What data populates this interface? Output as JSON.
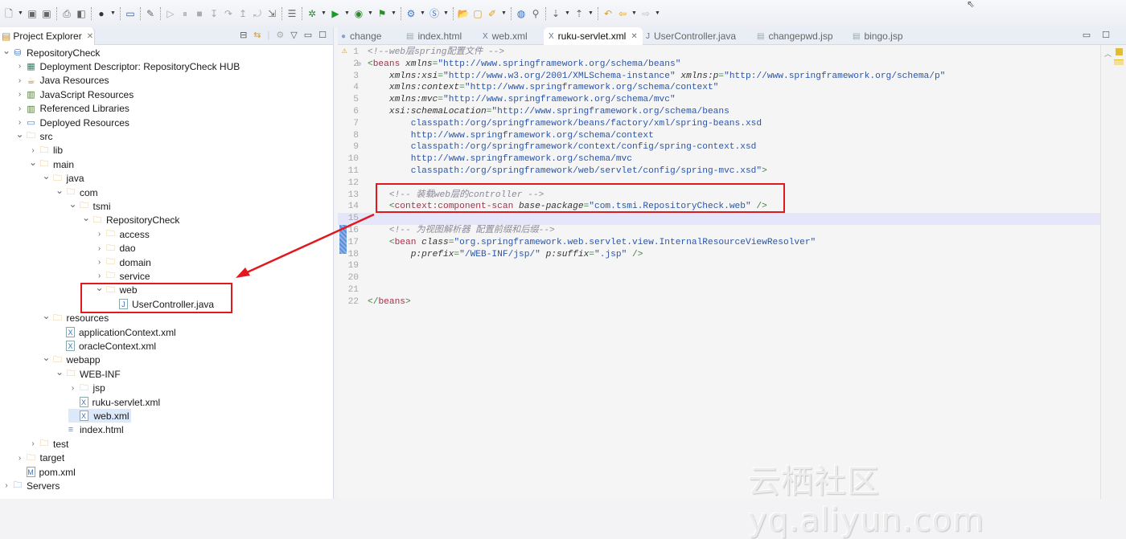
{
  "toolbar": {
    "icons": [
      "new-icon",
      "save-icon",
      "save-all-icon",
      "print-icon",
      "open-type-icon",
      "profile-icon",
      "terminal-icon",
      "pen-icon",
      "resume-icon",
      "suspend-icon",
      "stop-icon",
      "step-into-icon",
      "step-over-icon",
      "step-return-icon",
      "drop-frame-icon",
      "use-step-filters-icon",
      "task-icon",
      "debug-icon",
      "run-icon",
      "coverage-icon",
      "external-tools-icon",
      "new-server-icon",
      "new-web-service-icon",
      "open-folder-icon",
      "open-project-icon",
      "edit-icon",
      "globe-icon",
      "search-icon",
      "next-annotation-icon",
      "previous-annotation-icon",
      "last-edit-icon",
      "back-icon",
      "forward-icon"
    ]
  },
  "project_explorer": {
    "title": "Project Explorer",
    "tree": [
      {
        "label": "RepositoryCheck",
        "depth": 0,
        "expanded": true,
        "icon": "project-icon"
      },
      {
        "label": "Deployment Descriptor: RepositoryCheck HUB",
        "depth": 1,
        "expanded": false,
        "icon": "deployment-descriptor-icon"
      },
      {
        "label": "Java Resources",
        "depth": 1,
        "expanded": false,
        "icon": "java-resources-icon"
      },
      {
        "label": "JavaScript Resources",
        "depth": 1,
        "expanded": false,
        "icon": "library-icon"
      },
      {
        "label": "Referenced Libraries",
        "depth": 1,
        "expanded": false,
        "icon": "library-icon"
      },
      {
        "label": "Deployed Resources",
        "depth": 1,
        "expanded": false,
        "icon": "deployed-resources-icon"
      },
      {
        "label": "src",
        "depth": 1,
        "expanded": true,
        "icon": "folder-icon"
      },
      {
        "label": "lib",
        "depth": 2,
        "expanded": false,
        "icon": "folder-icon"
      },
      {
        "label": "main",
        "depth": 2,
        "expanded": true,
        "icon": "folder-icon"
      },
      {
        "label": "java",
        "depth": 3,
        "expanded": true,
        "icon": "folder-icon"
      },
      {
        "label": "com",
        "depth": 4,
        "expanded": true,
        "icon": "folder-icon"
      },
      {
        "label": "tsmi",
        "depth": 5,
        "expanded": true,
        "icon": "folder-icon"
      },
      {
        "label": "RepositoryCheck",
        "depth": 6,
        "expanded": true,
        "icon": "folder-icon"
      },
      {
        "label": "access",
        "depth": 7,
        "expanded": false,
        "icon": "folder-icon"
      },
      {
        "label": "dao",
        "depth": 7,
        "expanded": false,
        "icon": "folder-icon"
      },
      {
        "label": "domain",
        "depth": 7,
        "expanded": false,
        "icon": "folder-icon"
      },
      {
        "label": "service",
        "depth": 7,
        "expanded": false,
        "icon": "folder-icon"
      },
      {
        "label": "web",
        "depth": 7,
        "expanded": true,
        "icon": "folder-icon"
      },
      {
        "label": "UserController.java",
        "depth": 8,
        "leaf": true,
        "icon": "java-file-icon"
      },
      {
        "label": "resources",
        "depth": 3,
        "expanded": true,
        "icon": "folder-icon"
      },
      {
        "label": "applicationContext.xml",
        "depth": 4,
        "leaf": true,
        "icon": "xml-file-icon"
      },
      {
        "label": "oracleContext.xml",
        "depth": 4,
        "leaf": true,
        "icon": "xml-file-icon"
      },
      {
        "label": "webapp",
        "depth": 3,
        "expanded": true,
        "icon": "folder-icon"
      },
      {
        "label": "WEB-INF",
        "depth": 4,
        "expanded": true,
        "icon": "folder-icon"
      },
      {
        "label": "jsp",
        "depth": 5,
        "expanded": false,
        "icon": "folder-icon"
      },
      {
        "label": "ruku-servlet.xml",
        "depth": 5,
        "leaf": true,
        "icon": "xml-file-icon"
      },
      {
        "label": "web.xml",
        "depth": 5,
        "leaf": true,
        "icon": "xml-file-icon",
        "selected": true
      },
      {
        "label": "index.html",
        "depth": 4,
        "leaf": true,
        "icon": "html-file-icon"
      },
      {
        "label": "test",
        "depth": 2,
        "expanded": false,
        "icon": "folder-icon"
      },
      {
        "label": "target",
        "depth": 1,
        "expanded": false,
        "icon": "folder-icon"
      },
      {
        "label": "pom.xml",
        "depth": 1,
        "leaf": true,
        "icon": "maven-file-icon"
      },
      {
        "label": "Servers",
        "depth": 0,
        "expanded": false,
        "icon": "servers-folder-icon"
      }
    ]
  },
  "editor": {
    "tabs": [
      {
        "label": "change",
        "icon": "circle-icon"
      },
      {
        "label": "index.html",
        "icon": "html-file-icon"
      },
      {
        "label": "web.xml",
        "icon": "xml-file-icon"
      },
      {
        "label": "ruku-servlet.xml",
        "icon": "xml-file-icon",
        "active": true
      },
      {
        "label": "UserController.java",
        "icon": "java-file-icon"
      },
      {
        "label": "changepwd.jsp",
        "icon": "jsp-file-icon"
      },
      {
        "label": "bingo.jsp",
        "icon": "jsp-file-icon"
      }
    ],
    "lines": [
      {
        "n": "1",
        "parts": [
          [
            "cm",
            "<!--web层spring配置文件 -->"
          ]
        ]
      },
      {
        "n": "2",
        "parts": [
          [
            "tg",
            "<"
          ],
          [
            "tn",
            "beans"
          ],
          [
            "an",
            " xmlns"
          ],
          [
            "tg",
            "="
          ],
          [
            "av",
            "\"http://www.springframework.org/schema/beans\""
          ]
        ]
      },
      {
        "n": "3",
        "parts": [
          [
            "an",
            "    xmlns:xsi"
          ],
          [
            "tg",
            "="
          ],
          [
            "av",
            "\"http://www.w3.org/2001/XMLSchema-instance\""
          ],
          [
            "an",
            " xmlns:p"
          ],
          [
            "tg",
            "="
          ],
          [
            "av",
            "\"http://www.springframework.org/schema/p\""
          ]
        ]
      },
      {
        "n": "4",
        "parts": [
          [
            "an",
            "    xmlns:context"
          ],
          [
            "tg",
            "="
          ],
          [
            "av",
            "\"http://www.springframework.org/schema/context\""
          ]
        ]
      },
      {
        "n": "5",
        "parts": [
          [
            "an",
            "    xmlns:mvc"
          ],
          [
            "tg",
            "="
          ],
          [
            "av",
            "\"http://www.springframework.org/schema/mvc\""
          ]
        ]
      },
      {
        "n": "6",
        "parts": [
          [
            "an",
            "    xsi:schemaLocation"
          ],
          [
            "tg",
            "="
          ],
          [
            "av",
            "\"http://www.springframework.org/schema/beans"
          ]
        ]
      },
      {
        "n": "7",
        "parts": [
          [
            "av",
            "        classpath:/org/springframework/beans/factory/xml/spring-beans.xsd"
          ]
        ]
      },
      {
        "n": "8",
        "parts": [
          [
            "av",
            "        http://www.springframework.org/schema/context"
          ]
        ]
      },
      {
        "n": "9",
        "parts": [
          [
            "av",
            "        classpath:/org/springframework/context/config/spring-context.xsd"
          ]
        ]
      },
      {
        "n": "10",
        "parts": [
          [
            "av",
            "        http://www.springframework.org/schema/mvc"
          ]
        ]
      },
      {
        "n": "11",
        "parts": [
          [
            "av",
            "        classpath:/org/springframework/web/servlet/config/spring-mvc.xsd\""
          ],
          [
            "tg",
            ">"
          ]
        ]
      },
      {
        "n": "12",
        "parts": []
      },
      {
        "n": "13",
        "parts": [
          [
            "cm",
            "    <!-- 装载web层的controller -->"
          ]
        ]
      },
      {
        "n": "14",
        "parts": [
          [
            "tg",
            "    <"
          ],
          [
            "tn",
            "context:component-scan"
          ],
          [
            "an",
            " base-package"
          ],
          [
            "tg",
            "="
          ],
          [
            "av",
            "\"com.tsmi.RepositoryCheck.web\""
          ],
          [
            "tg",
            " />"
          ]
        ]
      },
      {
        "n": "15",
        "parts": []
      },
      {
        "n": "16",
        "parts": [
          [
            "cm",
            "    <!-- 为视图解析器 配置前缀和后缀-->"
          ]
        ]
      },
      {
        "n": "17",
        "parts": [
          [
            "tg",
            "    <"
          ],
          [
            "tn",
            "bean"
          ],
          [
            "an",
            " class"
          ],
          [
            "tg",
            "="
          ],
          [
            "av",
            "\"org.springframework.web.servlet.view.InternalResourceViewResolver\""
          ]
        ]
      },
      {
        "n": "18",
        "parts": [
          [
            "an",
            "        p:prefix"
          ],
          [
            "tg",
            "="
          ],
          [
            "av",
            "\"/WEB-INF/jsp/\""
          ],
          [
            "an",
            " p:suffix"
          ],
          [
            "tg",
            "="
          ],
          [
            "av",
            "\".jsp\""
          ],
          [
            "tg",
            " />"
          ]
        ]
      },
      {
        "n": "19",
        "parts": []
      },
      {
        "n": "20",
        "parts": []
      },
      {
        "n": "21",
        "parts": []
      },
      {
        "n": "22",
        "parts": [
          [
            "tg",
            "</"
          ],
          [
            "tn",
            "beans"
          ],
          [
            "tg",
            ">"
          ]
        ]
      }
    ]
  },
  "watermark": "云栖社区 yq.aliyun.com",
  "colors": {
    "annotation_red": "#e0191f",
    "selection": "#dbe9fb",
    "current_line": "#e6e6fa"
  }
}
